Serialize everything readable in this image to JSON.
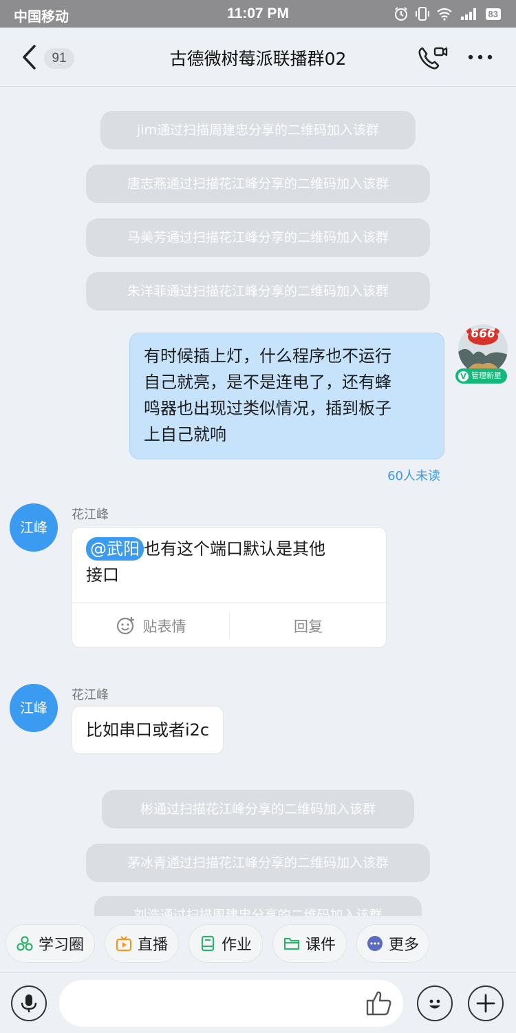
{
  "status_bar": {
    "carrier": "中国移动",
    "time": "11:07 PM",
    "battery": "83",
    "icons": [
      "alarm-icon",
      "vibrate-icon",
      "wifi-icon",
      "signal-icon",
      "battery-icon"
    ]
  },
  "header": {
    "back_count": "91",
    "title": "古德微树莓派联播群02",
    "icons": [
      "back-icon",
      "video-call-icon",
      "more-icon"
    ]
  },
  "system_messages_top": [
    "jim通过扫描周建忠分享的二维码加入该群",
    "唐志燕通过扫描花江峰分享的二维码加入该群",
    "马美芳通过扫描花江峰分享的二维码加入该群",
    "朱洋菲通过扫描花江峰分享的二维码加入该群"
  ],
  "my_message": {
    "lines": [
      "有时候插上灯，什么程序也不运行",
      "自己就亮，是不是连电了，还有蜂",
      "鸣器也出现过类似情况，插到板子",
      "上自己就响"
    ],
    "unread": "60人未读",
    "avatar_badge_text": "666",
    "vip_badge": "管理新星",
    "vip_letter": "V"
  },
  "message_1": {
    "avatar": "江峰",
    "sender": "花江峰",
    "mention": "@武阳",
    "text_line1": "也有这个端口默认是其他",
    "text_line2": "接口",
    "action_sticker": "贴表情",
    "action_reply": "回复"
  },
  "message_2": {
    "avatar": "江峰",
    "sender": "花江峰",
    "text": "比如串口或者i2c"
  },
  "system_messages_bottom": [
    "彬通过扫描花江峰分享的二维码加入该群",
    "茅冰青通过扫描花江峰分享的二维码加入该群",
    "刘浩通过扫描周建忠分享的二维码加入该群"
  ],
  "quick_actions": [
    {
      "label": "学习圈",
      "icon": "study-circle-icon",
      "color": "#2db36b"
    },
    {
      "label": "直播",
      "icon": "live-tv-icon",
      "color": "#f39a1d"
    },
    {
      "label": "作业",
      "icon": "homework-icon",
      "color": "#2db36b"
    },
    {
      "label": "课件",
      "icon": "folder-icon",
      "color": "#2db36b"
    },
    {
      "label": "更多",
      "icon": "more-dots-icon",
      "color": "#5b6bbf"
    }
  ],
  "input_bar": {
    "placeholder": "",
    "icons": [
      "microphone-icon",
      "thumbs-up-icon",
      "emoji-icon",
      "plus-icon"
    ]
  }
}
